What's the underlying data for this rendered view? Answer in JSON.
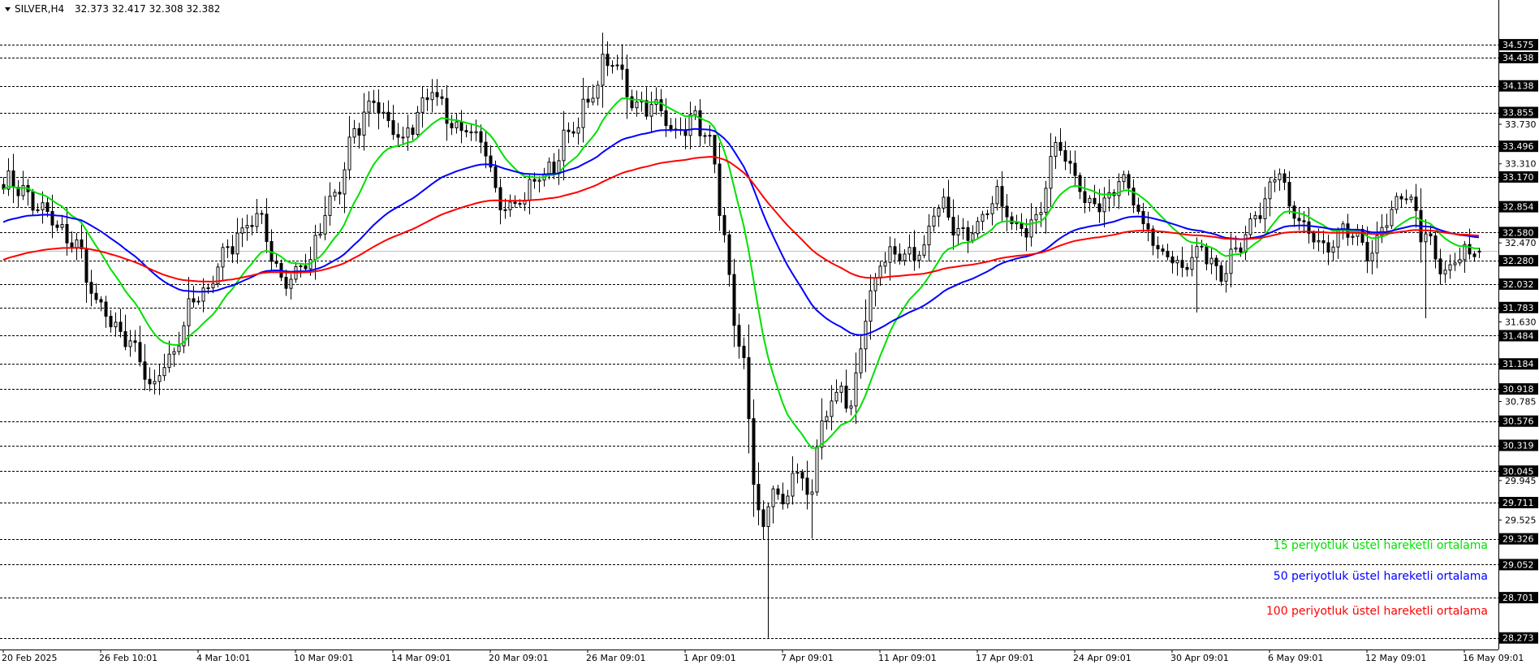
{
  "header": {
    "symbol": "SILVER,H4",
    "ohlc": "32.373 32.417 32.308 32.382"
  },
  "legend": [
    {
      "label": "15 periyotluk üstel hareketli ortalama",
      "color": "#00e000"
    },
    {
      "label": "50 periyotluk üstel hareketli ortalama",
      "color": "#0000ff"
    },
    {
      "label": "100 periyotluk üstel hareketli ortalama",
      "color": "#ff0000"
    }
  ],
  "chart_data": {
    "type": "candlestick",
    "symbol": "SILVER",
    "timeframe": "H4",
    "ylim": [
      28.15,
      35.05
    ],
    "current_price": 32.382,
    "level_lines": [
      34.575,
      34.438,
      34.138,
      33.855,
      33.496,
      33.17,
      32.854,
      32.58,
      32.28,
      32.032,
      31.783,
      31.484,
      31.184,
      30.918,
      30.576,
      30.319,
      30.045,
      29.711,
      29.326,
      29.052,
      28.701,
      28.273
    ],
    "plain_ticks": [
      "33.730",
      "33.310",
      "32.470",
      "31.630",
      "30.785",
      "29.945",
      "29.525"
    ],
    "x_labels": [
      "20 Feb 2025",
      "26 Feb 10:01",
      "4 Mar 10:01",
      "10 Mar 09:01",
      "14 Mar 09:01",
      "20 Mar 09:01",
      "26 Mar 09:01",
      "1 Apr 09:01",
      "7 Apr 09:01",
      "11 Apr 09:01",
      "17 Apr 09:01",
      "24 Apr 09:01",
      "30 Apr 09:01",
      "6 May 09:01",
      "12 May 09:01",
      "16 May 09:01"
    ],
    "x_label_bars": [
      0,
      20,
      40,
      60,
      80,
      100,
      120,
      140,
      160,
      180,
      200,
      220,
      240,
      260,
      280,
      300
    ],
    "price_anchors": [
      [
        0,
        33.1
      ],
      [
        8,
        32.85
      ],
      [
        14,
        32.45
      ],
      [
        20,
        31.8
      ],
      [
        26,
        31.35
      ],
      [
        30,
        30.95
      ],
      [
        34,
        31.3
      ],
      [
        40,
        31.85
      ],
      [
        46,
        32.45
      ],
      [
        52,
        32.7
      ],
      [
        58,
        32.1
      ],
      [
        62,
        32.2
      ],
      [
        68,
        33.0
      ],
      [
        72,
        33.6
      ],
      [
        76,
        33.95
      ],
      [
        82,
        33.6
      ],
      [
        88,
        34.05
      ],
      [
        94,
        33.7
      ],
      [
        98,
        33.45
      ],
      [
        102,
        32.95
      ],
      [
        106,
        32.95
      ],
      [
        112,
        33.2
      ],
      [
        116,
        33.7
      ],
      [
        120,
        33.9
      ],
      [
        124,
        34.4
      ],
      [
        126,
        34.35
      ],
      [
        130,
        33.95
      ],
      [
        134,
        33.85
      ],
      [
        138,
        33.7
      ],
      [
        142,
        33.8
      ],
      [
        145,
        33.45
      ],
      [
        148,
        32.5
      ],
      [
        150,
        31.7
      ],
      [
        152,
        31.2
      ],
      [
        154,
        30.0
      ],
      [
        156,
        29.3
      ],
      [
        158,
        29.9
      ],
      [
        160,
        29.6
      ],
      [
        162,
        30.1
      ],
      [
        164,
        30.0
      ],
      [
        166,
        29.8
      ],
      [
        168,
        30.5
      ],
      [
        170,
        30.7
      ],
      [
        172,
        30.95
      ],
      [
        174,
        30.75
      ],
      [
        176,
        31.4
      ],
      [
        178,
        31.9
      ],
      [
        180,
        32.25
      ],
      [
        184,
        32.35
      ],
      [
        188,
        32.4
      ],
      [
        192,
        32.85
      ],
      [
        196,
        32.6
      ],
      [
        200,
        32.65
      ],
      [
        204,
        32.9
      ],
      [
        208,
        32.6
      ],
      [
        212,
        32.8
      ],
      [
        216,
        33.45
      ],
      [
        220,
        33.25
      ],
      [
        222,
        32.95
      ],
      [
        226,
        32.85
      ],
      [
        230,
        33.15
      ],
      [
        234,
        32.7
      ],
      [
        238,
        32.35
      ],
      [
        242,
        32.2
      ],
      [
        246,
        32.45
      ],
      [
        250,
        32.15
      ],
      [
        254,
        32.45
      ],
      [
        258,
        32.85
      ],
      [
        262,
        33.2
      ],
      [
        264,
        32.8
      ],
      [
        268,
        32.6
      ],
      [
        272,
        32.4
      ],
      [
        276,
        32.55
      ],
      [
        280,
        32.4
      ],
      [
        284,
        32.7
      ],
      [
        288,
        32.95
      ],
      [
        292,
        32.55
      ],
      [
        296,
        32.15
      ],
      [
        300,
        32.3
      ],
      [
        303,
        32.382
      ]
    ],
    "wick_extremes": [
      [
        26,
        31.26,
        "low"
      ],
      [
        31,
        30.86,
        "low"
      ],
      [
        89,
        34.21,
        "high"
      ],
      [
        127,
        34.58,
        "high"
      ],
      [
        146,
        33.42,
        "high"
      ],
      [
        157,
        28.273,
        "low"
      ],
      [
        166,
        29.33,
        "low"
      ],
      [
        216,
        33.6,
        "high"
      ],
      [
        245,
        31.73,
        "low"
      ],
      [
        262,
        33.26,
        "high"
      ],
      [
        292,
        31.67,
        "low"
      ]
    ],
    "series": [
      {
        "name": "15 periyotluk üstel hareketli ortalama",
        "period": 15,
        "color": "#00e000"
      },
      {
        "name": "50 periyotluk üstel hareketli ortalama",
        "period": 50,
        "color": "#0000ff"
      },
      {
        "name": "100 periyotluk üstel hareketli ortalama",
        "period": 100,
        "color": "#ff0000"
      }
    ],
    "zone": {
      "top": 32.58,
      "bottom": 32.28,
      "start_bar": 282,
      "color": "#a8dce5"
    },
    "grid": "horizontal dashed",
    "legend_placement": "bottom-right"
  }
}
